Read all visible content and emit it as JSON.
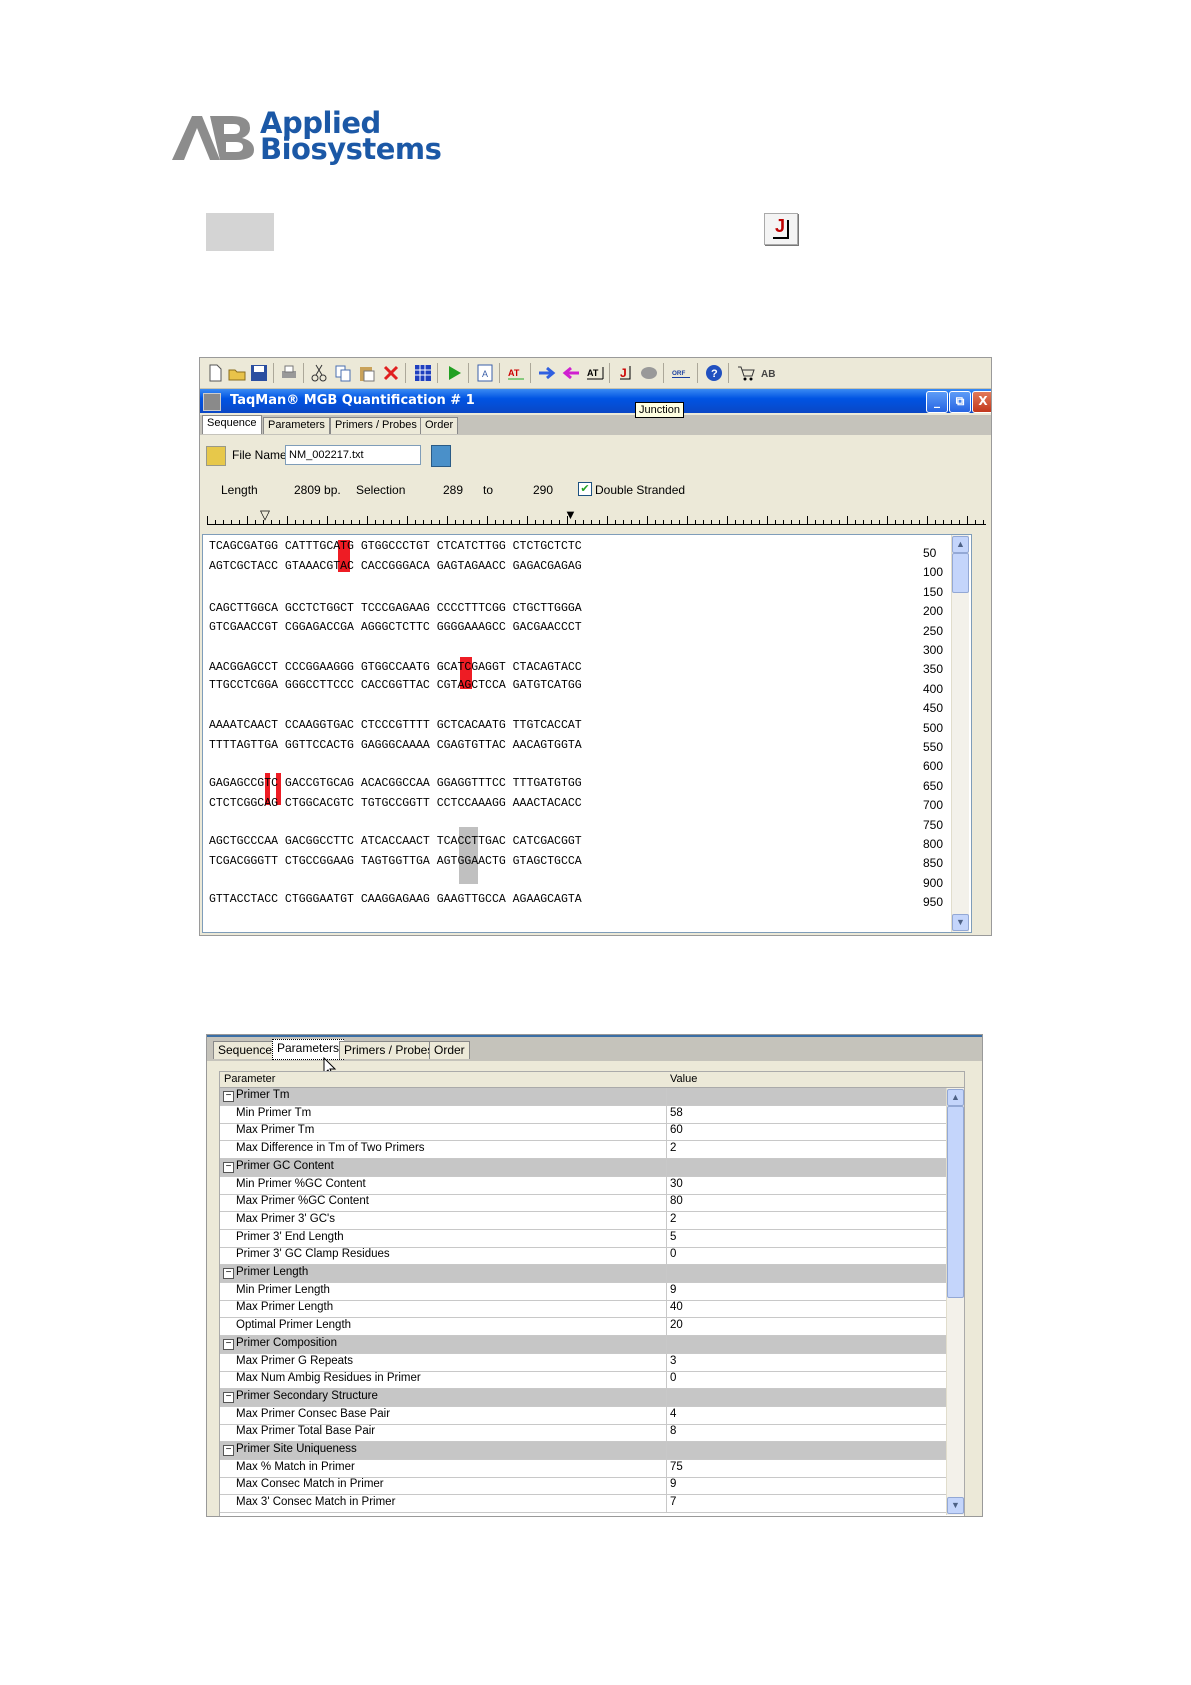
{
  "logo": {
    "line1": "Applied",
    "line2": "Biosystems"
  },
  "window": {
    "title": "TaqMan® MGB Quantification # 1",
    "tooltip": "Junction",
    "controls": [
      "_",
      "⧉",
      "X"
    ]
  },
  "toolbar": {
    "icons": [
      "new-icon",
      "open-icon",
      "save-icon",
      "print-icon",
      "cut-icon",
      "copy-icon",
      "paste-icon",
      "delete-icon",
      "grid-icon",
      "run-icon",
      "annotate-icon",
      "at-icon",
      "forward-arrow-icon",
      "back-arrow-icon",
      "at-box-icon",
      "junction-icon",
      "brain-icon",
      "orf-icon",
      "help-icon",
      "cart-icon",
      "ab-logo-icon"
    ]
  },
  "tabs": [
    "Sequence",
    "Parameters",
    "Primers / Probes",
    "Order"
  ],
  "sequence_tab": {
    "file_name_label": "File Name",
    "file_name_value": "NM_002217.txt",
    "length_label": "Length",
    "length_value": "2809 bp.",
    "selection_label": "Selection",
    "selection_from": "289",
    "to_label": "to",
    "selection_to": "290",
    "double_stranded_label": "Double Stranded",
    "double_stranded_checked": true
  },
  "sequence_lines": [
    "TCAGCGATGG CATTTGCATG GTGGCCCTGT CTCATCTTGG CTCTGCTCTC",
    "AGTCGCTACC GTAAACGTAC CACCGGGACA GAGTAGAACC GAGACGAGAG",
    "",
    "CAGCTTGGCA GCCTCTGGCT TCCCGAGAAG CCCCTTTCGG CTGCTTGGGA",
    "GTCGAACCGT CGGAGACCGA AGGGCTCTTC GGGGAAAGCC GACGAACCCT",
    "",
    "AACGGAGCCT CCCGGAAGGG GTGGCCAATG GCATCGAGGT CTACAGTACC",
    "TTGCCTCGGA GGGCCTTCCC CACCGGTTAC CGTAGCTCCA GATGTCATGG",
    "",
    "AAAATCAACT CCAAGGTGAC CTCCCGTTTT GCTCACAATG TTGTCACCAT",
    "TTTTAGTTGA GGTTCCACTG GAGGGCAAAA CGAGTGTTAC AACAGTGGTA",
    "",
    "GAGAGCCGTC GACCGTGCAG ACACGGCCAA GGAGGTTTCC TTTGATGTGG",
    "CTCTCGGCAG CTGGCACGTC TGTGCCGGTT CCTCCAAAGG AAACTACACC",
    "",
    "AGCTGCCCAA GACGGCCTTC ATCACCAACT TCACCTTGAC CATCGACGGT",
    "TCGACGGGTT CTGCCGGAAG TAGTGGTTGA AGTGGAACTG GTAGCTGCCA",
    "",
    "GTTACCTACC CTGGGAATGT CAAGGAGAAG GAAGTTGCCA AGAAGCAGTA"
  ],
  "sequence_numbers": [
    "50",
    "100",
    "150",
    "200",
    "250",
    "300",
    "350",
    "400",
    "450",
    "500",
    "550",
    "600",
    "650",
    "700",
    "750",
    "800",
    "850",
    "900",
    "950"
  ],
  "parameters_tab": {
    "col_parameter": "Parameter",
    "col_value": "Value",
    "rows": [
      {
        "section": true,
        "name": "Primer Tm",
        "value": ""
      },
      {
        "section": false,
        "name": "Min Primer Tm",
        "value": "58"
      },
      {
        "section": false,
        "name": "Max Primer Tm",
        "value": "60"
      },
      {
        "section": false,
        "name": "Max Difference in Tm of Two Primers",
        "value": "2"
      },
      {
        "section": true,
        "name": "Primer GC Content",
        "value": ""
      },
      {
        "section": false,
        "name": "Min Primer %GC Content",
        "value": "30"
      },
      {
        "section": false,
        "name": "Max Primer %GC Content",
        "value": "80"
      },
      {
        "section": false,
        "name": "Max Primer 3' GC's",
        "value": "2"
      },
      {
        "section": false,
        "name": "Primer 3' End Length",
        "value": "5"
      },
      {
        "section": false,
        "name": "Primer 3' GC Clamp Residues",
        "value": "0"
      },
      {
        "section": true,
        "name": "Primer Length",
        "value": ""
      },
      {
        "section": false,
        "name": "Min Primer Length",
        "value": "9"
      },
      {
        "section": false,
        "name": "Max Primer Length",
        "value": "40"
      },
      {
        "section": false,
        "name": "Optimal Primer Length",
        "value": "20"
      },
      {
        "section": true,
        "name": "Primer Composition",
        "value": ""
      },
      {
        "section": false,
        "name": "Max Primer G Repeats",
        "value": "3"
      },
      {
        "section": false,
        "name": "Max Num Ambig Residues in Primer",
        "value": "0"
      },
      {
        "section": true,
        "name": "Primer Secondary Structure",
        "value": ""
      },
      {
        "section": false,
        "name": "Max Primer Consec Base Pair",
        "value": "4"
      },
      {
        "section": false,
        "name": "Max Primer Total Base Pair",
        "value": "8"
      },
      {
        "section": true,
        "name": "Primer Site Uniqueness",
        "value": ""
      },
      {
        "section": false,
        "name": "Max % Match in Primer",
        "value": "75"
      },
      {
        "section": false,
        "name": "Max Consec Match in Primer",
        "value": "9"
      },
      {
        "section": false,
        "name": "Max 3' Consec Match in Primer",
        "value": "7"
      }
    ]
  }
}
